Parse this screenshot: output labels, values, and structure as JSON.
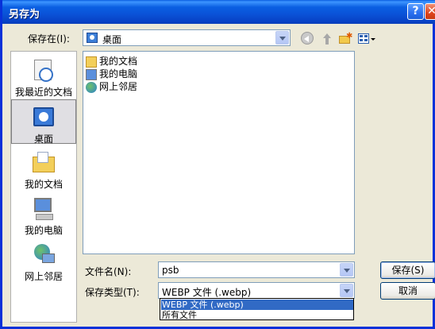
{
  "window": {
    "title": "另存为",
    "help_glyph": "?",
    "close_glyph": "✕"
  },
  "save_in": {
    "label": "保存在(I):",
    "value": "桌面"
  },
  "places": [
    {
      "label": "我最近的文档",
      "icon": "recent-documents-icon"
    },
    {
      "label": "桌面",
      "icon": "desktop-icon"
    },
    {
      "label": "我的文档",
      "icon": "my-documents-icon"
    },
    {
      "label": "我的电脑",
      "icon": "my-computer-icon"
    },
    {
      "label": "网上邻居",
      "icon": "network-places-icon"
    }
  ],
  "files": [
    {
      "name": "我的文档",
      "icon": "folder-icon"
    },
    {
      "name": "我的电脑",
      "icon": "computer-icon"
    },
    {
      "name": "网上邻居",
      "icon": "network-icon"
    }
  ],
  "filename": {
    "label": "文件名(N):",
    "value": "psb"
  },
  "filetype": {
    "label": "保存类型(T):",
    "value": "WEBP 文件 (.webp)",
    "options": [
      "WEBP 文件 (.webp)",
      "所有文件"
    ]
  },
  "buttons": {
    "save": "保存(S)",
    "cancel": "取消"
  },
  "colors": {
    "titlebar": "#0a52d7",
    "selection": "#316ac5",
    "face": "#ece9d8"
  }
}
